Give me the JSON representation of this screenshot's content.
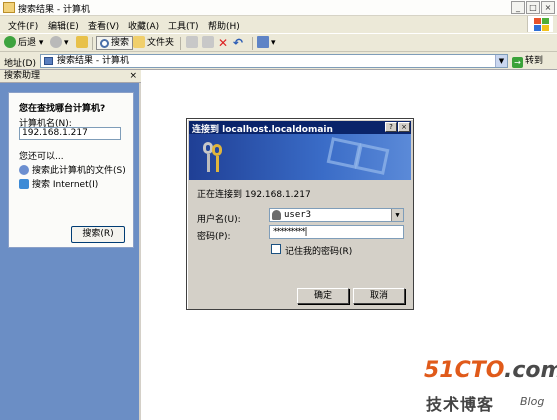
{
  "window": {
    "title": "搜索结果 - 计算机",
    "min_label": "_",
    "max_label": "□",
    "close_label": "×"
  },
  "menu": {
    "items": [
      "文件(F)",
      "编辑(E)",
      "查看(V)",
      "收藏(A)",
      "工具(T)",
      "帮助(H)"
    ]
  },
  "toolbar": {
    "back_label": "后退",
    "search_label": "搜索",
    "folders_label": "文件夹"
  },
  "address": {
    "label": "地址(D)",
    "value": "搜索结果 - 计算机",
    "go_label": "转到"
  },
  "search_pane": {
    "title": "搜索助理",
    "close_label": "×",
    "question": "您在查找哪台计算机?",
    "field_label": "计算机名(N):",
    "field_value": "192.168.1.217",
    "also_label": "您还可以...",
    "link_files": "搜索此计算机的文件(S)",
    "link_internet": "搜索 Internet(I)",
    "search_button": "搜索(R)"
  },
  "dialog": {
    "title": "连接到 localhost.localdomain",
    "help_label": "?",
    "close_label": "×",
    "connecting_text": "正在连接到 192.168.1.217",
    "username_label": "用户名(U):",
    "username_value": "user3",
    "password_label": "密码(P):",
    "password_value": "*********|",
    "remember_label": "记住我的密码(R)",
    "remember_checked": false,
    "ok_label": "确定",
    "cancel_label": "取消"
  },
  "watermark": {
    "site_main": "51CTO",
    "site_suffix": ".com",
    "subtitle": "技术博客",
    "blog": "Blog"
  }
}
